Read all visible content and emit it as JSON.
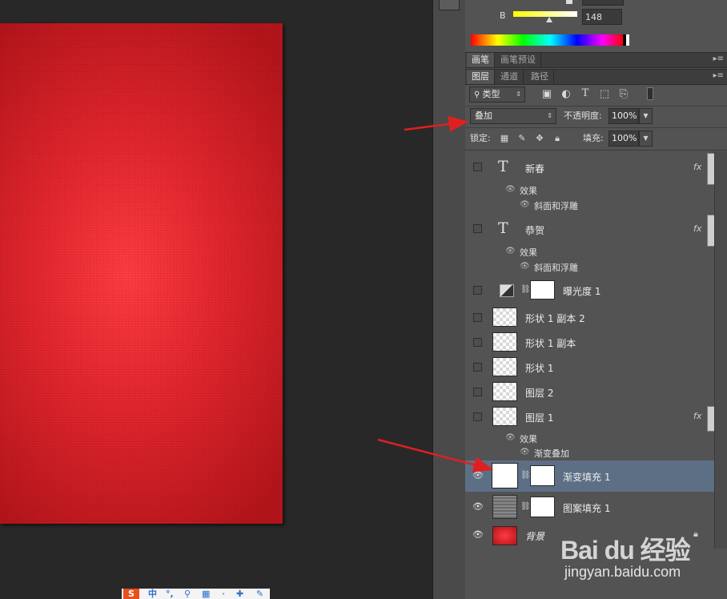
{
  "color_panel": {
    "channel_label": "B",
    "channel_value": "148"
  },
  "tabs_top": {
    "items": [
      {
        "label": "画笔",
        "active": true
      },
      {
        "label": "画笔预设",
        "active": false
      }
    ]
  },
  "tabs_layers": {
    "items": [
      {
        "label": "图层",
        "active": true
      },
      {
        "label": "通道",
        "active": false
      },
      {
        "label": "路径",
        "active": false
      }
    ]
  },
  "toolbar": {
    "filter_kind": "类型",
    "blend_mode": "叠加",
    "opacity_label": "不透明度:",
    "opacity_value": "100%",
    "lock_label": "锁定:",
    "fill_label": "填充:",
    "fill_value": "100%"
  },
  "layers": [
    {
      "name": "新春",
      "kind": "text",
      "visible": false,
      "fx": "fx",
      "effects_label": "效果",
      "effect": "斜面和浮雕"
    },
    {
      "name": "恭贺",
      "kind": "text",
      "visible": false,
      "fx": "fx",
      "effects_label": "效果",
      "effect": "斜面和浮雕"
    },
    {
      "name": "曝光度 1",
      "kind": "adjustment",
      "visible": false
    },
    {
      "name": "形状 1 副本 2",
      "kind": "shape",
      "visible": false
    },
    {
      "name": "形状 1 副本",
      "kind": "shape",
      "visible": false
    },
    {
      "name": "形状 1",
      "kind": "shape",
      "visible": false
    },
    {
      "name": "图层 2",
      "kind": "pixel",
      "visible": false
    },
    {
      "name": "图层 1",
      "kind": "pixel",
      "visible": false,
      "fx": "fx",
      "effects_label": "效果",
      "effect": "渐变叠加"
    },
    {
      "name": "渐变填充 1",
      "kind": "fill",
      "visible": true,
      "selected": true
    },
    {
      "name": "图案填充 1",
      "kind": "fill",
      "visible": true
    },
    {
      "name": "背景",
      "kind": "background",
      "visible": true,
      "locked": true
    }
  ],
  "watermark": {
    "logo": "Bai du 经验",
    "url": "jingyan.baidu.com"
  },
  "ime_bar": {
    "text": "中"
  },
  "colors": {
    "panel_bg": "#535353",
    "selected_row": "#5d6f85",
    "canvas_red": "#e3262d",
    "annotation_arrow": "#e02020"
  }
}
